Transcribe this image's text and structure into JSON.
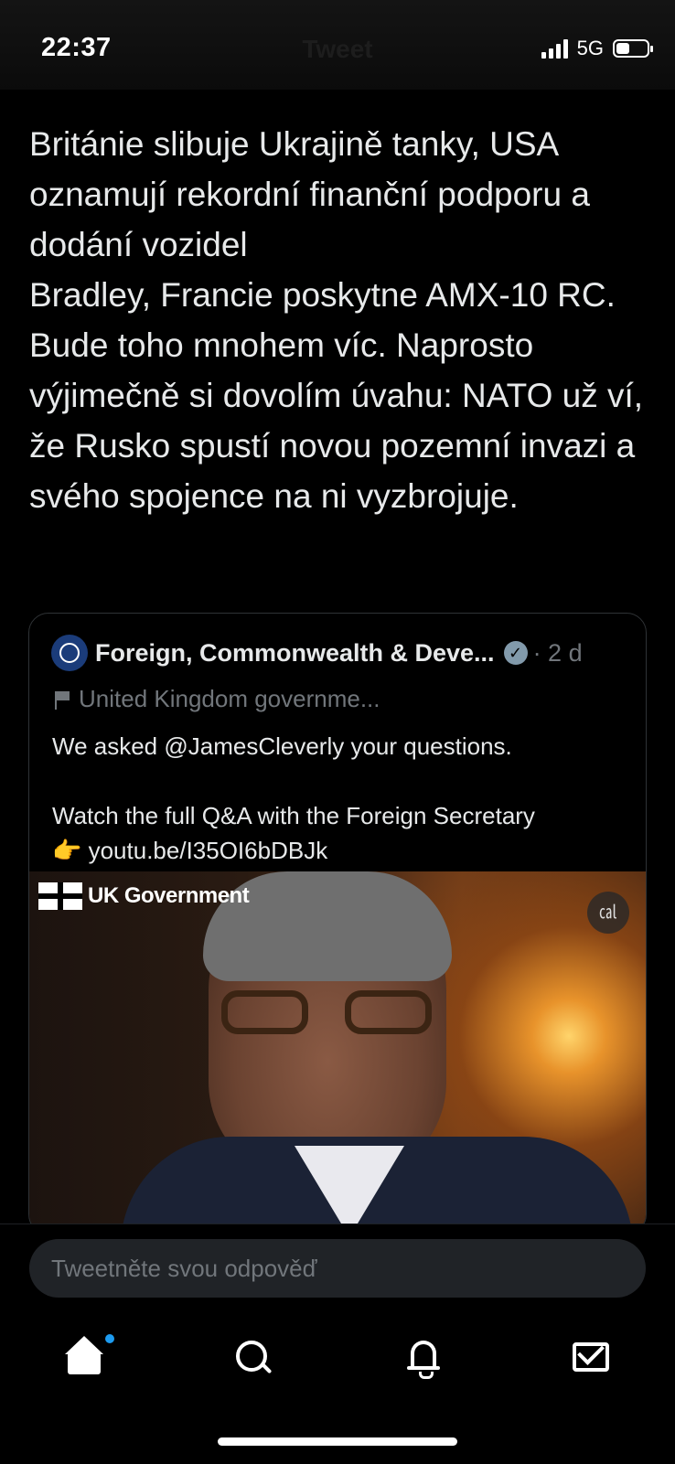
{
  "status_bar": {
    "time": "22:37",
    "network": "5G",
    "ghost_title": "Tweet"
  },
  "tweet": {
    "text": "Británie slibuje Ukrajině tanky, USA oznamují rekordní finanční podporu a dodání vozidel\nBradley, Francie poskytne AMX-10 RC. Bude toho mnohem víc. Naprosto výjimečně si dovolím úvahu: NATO už ví, že Rusko spustí novou pozemní invazi a svého spojence na ni vyzbrojuje."
  },
  "quoted_tweet": {
    "author_name": "Foreign, Commonwealth & Deve...",
    "time": "· 2 d",
    "label": "United Kingdom governme...",
    "text": "We asked @JamesCleverly your questions.\n\nWatch the full Q&A with the Foreign Secretary\n👉 youtu.be/I35OI6bDBJk",
    "media": {
      "logo_text": "UK Government",
      "caption_icon": "captions-icon"
    }
  },
  "reply": {
    "placeholder": "Tweetněte svou odpověď"
  },
  "tab_bar": {
    "items": [
      "home-icon",
      "search-icon",
      "bell-icon",
      "mail-icon"
    ],
    "accent": "#1d9bf0"
  }
}
